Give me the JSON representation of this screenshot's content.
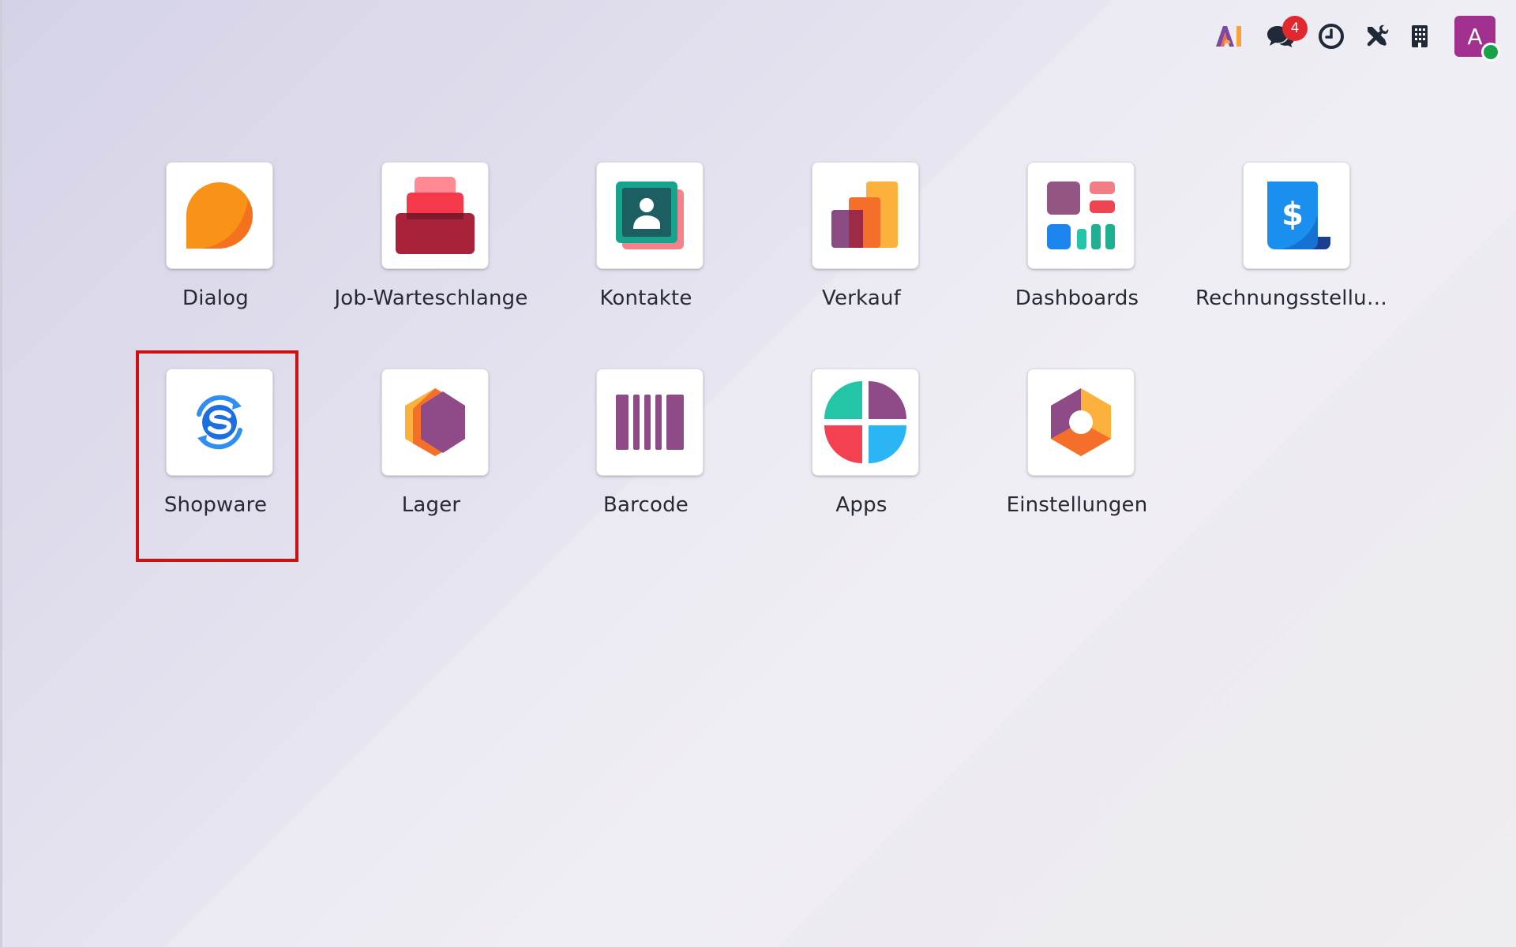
{
  "systray": {
    "ai_icon": "ai-logo-icon",
    "messages_badge": "4",
    "messages_icon": "chat-bubbles-icon",
    "activity_icon": "clock-icon",
    "tools_icon": "tools-icon",
    "company_icon": "building-icon",
    "avatar_initial": "A",
    "avatar_color": "#a2308f",
    "presence_color": "#16a34a"
  },
  "apps": [
    {
      "label": "Dialog",
      "icon": "discuss-bubble-icon"
    },
    {
      "label": "Job-Warteschlange",
      "icon": "job-queue-stack-icon"
    },
    {
      "label": "Kontakte",
      "icon": "contact-card-icon"
    },
    {
      "label": "Verkauf",
      "icon": "sales-bars-icon"
    },
    {
      "label": "Dashboards",
      "icon": "dashboard-blocks-icon"
    },
    {
      "label": "Rechnungsstellung",
      "icon": "invoice-dollar-icon"
    },
    {
      "label": "Shopware",
      "icon": "shopware-sync-icon"
    },
    {
      "label": "Lager",
      "icon": "inventory-hexagon-icon"
    },
    {
      "label": "Barcode",
      "icon": "barcode-icon"
    },
    {
      "label": "Apps",
      "icon": "apps-quadrant-icon"
    },
    {
      "label": "Einstellungen",
      "icon": "settings-hexagon-icon"
    }
  ],
  "highlight_color": "#cc1111"
}
